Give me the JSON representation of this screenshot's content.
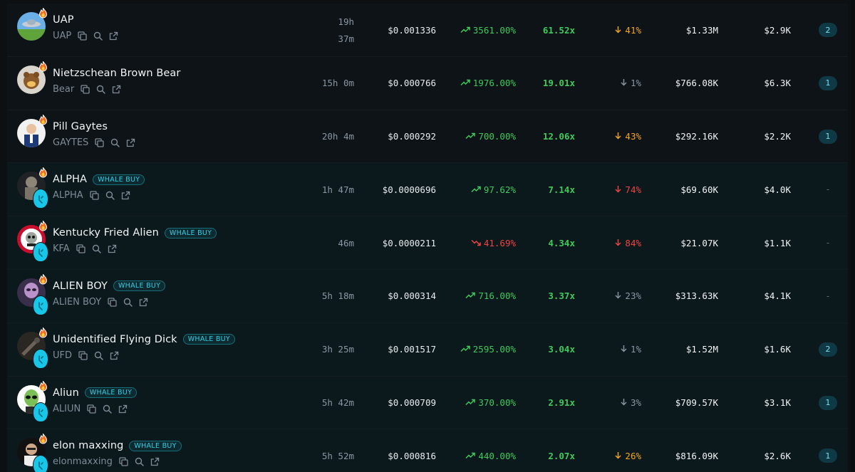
{
  "rows": [
    {
      "name": "UAP",
      "ticker": "UAP",
      "whale": false,
      "badge": "",
      "age": "19h",
      "age2": "37m",
      "price": "$0.001336",
      "change": "3561.00%",
      "change_dir": "up",
      "multiplier": "61.52x",
      "drawdown": "41%",
      "drawdown_color": "orange",
      "mcap": "$1.33M",
      "volume": "$2.9K",
      "count": "2",
      "avatar": "ufo"
    },
    {
      "name": "Nietzschean Brown Bear",
      "ticker": "Bear",
      "whale": false,
      "badge": "",
      "age": "15h 0m",
      "age2": "",
      "price": "$0.000766",
      "change": "1976.00%",
      "change_dir": "up",
      "multiplier": "19.01x",
      "drawdown": "1%",
      "drawdown_color": "gray",
      "mcap": "$766.08K",
      "volume": "$6.3K",
      "count": "1",
      "avatar": "bear"
    },
    {
      "name": "Pill Gaytes",
      "ticker": "GAYTES",
      "whale": false,
      "badge": "",
      "age": "20h 4m",
      "age2": "",
      "price": "$0.000292",
      "change": "700.00%",
      "change_dir": "up",
      "multiplier": "12.06x",
      "drawdown": "43%",
      "drawdown_color": "orange",
      "mcap": "$292.16K",
      "volume": "$2.2K",
      "count": "1",
      "avatar": "person"
    },
    {
      "name": "ALPHA",
      "ticker": "ALPHA",
      "whale": true,
      "badge": "WHALE BUY",
      "age": "1h 47m",
      "age2": "",
      "price": "$0.0000696",
      "change": "97.62%",
      "change_dir": "up",
      "multiplier": "7.14x",
      "drawdown": "74%",
      "drawdown_color": "red",
      "mcap": "$69.60K",
      "volume": "$4.0K",
      "count": "-",
      "avatar": "statue"
    },
    {
      "name": "Kentucky Fried Alien",
      "ticker": "KFA",
      "whale": true,
      "badge": "WHALE BUY",
      "age": "46m",
      "age2": "",
      "price": "$0.0000211",
      "change": "41.69%",
      "change_dir": "down",
      "multiplier": "4.34x",
      "drawdown": "84%",
      "drawdown_color": "red",
      "mcap": "$21.07K",
      "volume": "$1.1K",
      "count": "-",
      "avatar": "kfc"
    },
    {
      "name": "ALIEN BOY",
      "ticker": "ALIEN BOY",
      "whale": true,
      "badge": "WHALE BUY",
      "age": "5h 18m",
      "age2": "",
      "price": "$0.000314",
      "change": "716.00%",
      "change_dir": "up",
      "multiplier": "3.37x",
      "drawdown": "23%",
      "drawdown_color": "gray",
      "mcap": "$313.63K",
      "volume": "$4.1K",
      "count": "-",
      "avatar": "alienboy"
    },
    {
      "name": "Unidentified Flying Dick",
      "ticker": "UFD",
      "whale": true,
      "badge": "WHALE BUY",
      "age": "3h 25m",
      "age2": "",
      "price": "$0.001517",
      "change": "2595.00%",
      "change_dir": "up",
      "multiplier": "3.04x",
      "drawdown": "1%",
      "drawdown_color": "gray",
      "mcap": "$1.52M",
      "volume": "$1.6K",
      "count": "2",
      "avatar": "dark"
    },
    {
      "name": "Aliun",
      "ticker": "ALIUN",
      "whale": true,
      "badge": "WHALE BUY",
      "age": "5h 42m",
      "age2": "",
      "price": "$0.000709",
      "change": "370.00%",
      "change_dir": "up",
      "multiplier": "2.91x",
      "drawdown": "3%",
      "drawdown_color": "gray",
      "mcap": "$709.57K",
      "volume": "$3.1K",
      "count": "1",
      "avatar": "greenalien"
    },
    {
      "name": "elon maxxing",
      "ticker": "elonmaxxing",
      "whale": true,
      "badge": "WHALE BUY",
      "age": "5h 52m",
      "age2": "",
      "price": "$0.000816",
      "change": "440.00%",
      "change_dir": "up",
      "multiplier": "2.07x",
      "drawdown": "26%",
      "drawdown_color": "orange",
      "mcap": "$816.09K",
      "volume": "$2.6K",
      "count": "1",
      "avatar": "elon"
    }
  ],
  "colors": {
    "positive": "#3fca5c",
    "negative": "#ef4444",
    "warning": "#f5a623",
    "muted": "#8a96a3",
    "accent": "#17c6e8"
  },
  "icons": {
    "fire": "fire-icon",
    "copy": "copy-icon",
    "search": "search-icon",
    "external": "external-link-icon",
    "whale_drop": "whale-drop-icon",
    "trend_up": "trend-up-icon",
    "trend_down": "trend-down-icon",
    "arrow_down": "arrow-down-icon"
  }
}
